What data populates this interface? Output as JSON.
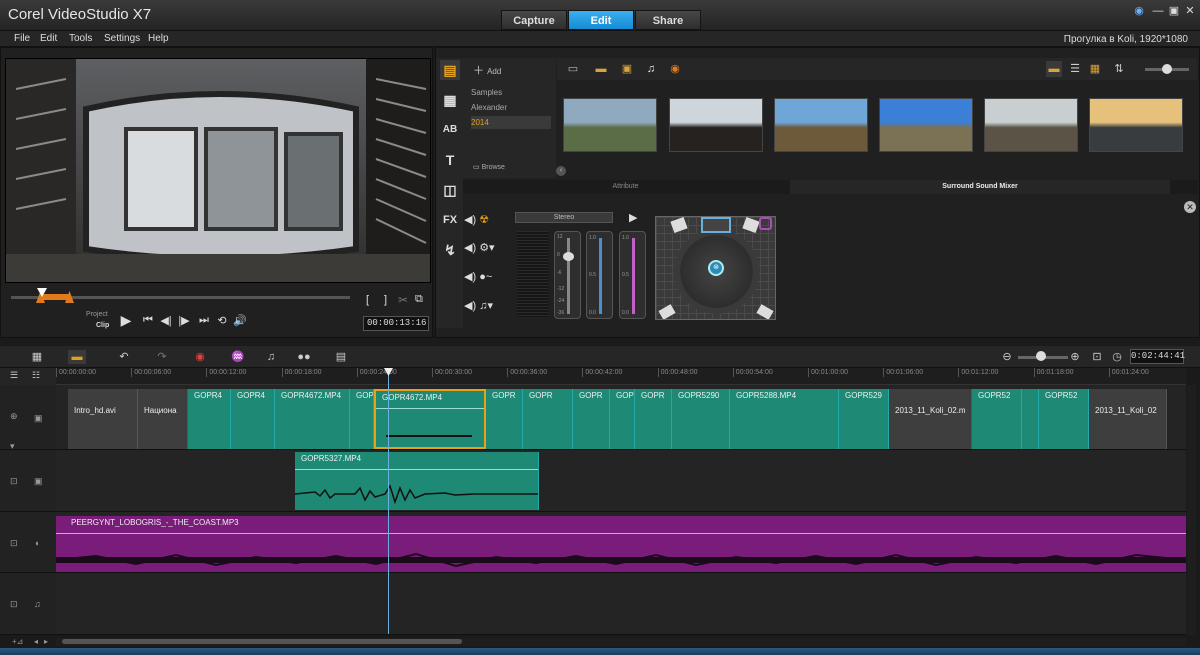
{
  "app": {
    "title": "Corel VideoStudio X7"
  },
  "main_tabs": [
    {
      "label": "Capture"
    },
    {
      "label": "Edit"
    },
    {
      "label": "Share"
    }
  ],
  "window_controls": {
    "globe_icon": "globe-icon",
    "minimize": "—",
    "restore": "▣",
    "close": "✕"
  },
  "menu": [
    "File",
    "Edit",
    "Tools",
    "Settings",
    "Help"
  ],
  "project_info": "Прогулка в Koli, 1920*1080",
  "player": {
    "mode_project": "Project",
    "mode_clip": "Clip",
    "timecode": "00:00:13:16",
    "controls": {
      "play": "▶",
      "home": "⏮",
      "prev_frame": "◀|",
      "next_frame": "|▶",
      "end": "⏭",
      "repeat": "⟲",
      "volume": "🔊"
    },
    "mark_in": "[",
    "mark_out": "]"
  },
  "library": {
    "add_label": "Add",
    "browse_label": "Browse",
    "folders": [
      "Samples",
      "Alexander",
      "2014"
    ],
    "selected_folder": "2014",
    "thumbnails": [
      {
        "name": "thumb-1",
        "colors": [
          "#8fa9bf",
          "#5b6d46"
        ]
      },
      {
        "name": "thumb-2",
        "colors": [
          "#cfd6db",
          "#262220"
        ]
      },
      {
        "name": "thumb-3",
        "colors": [
          "#6ea6d8",
          "#6d5a3a"
        ]
      },
      {
        "name": "thumb-4",
        "colors": [
          "#3b7fd6",
          "#7b7255"
        ]
      },
      {
        "name": "thumb-5",
        "colors": [
          "#c9ced0",
          "#5a5346"
        ]
      },
      {
        "name": "thumb-6",
        "colors": [
          "#e5c17c",
          "#383c3e"
        ]
      }
    ]
  },
  "options": {
    "tab_attribute": "Attribute",
    "tab_surround": "Surround Sound Mixer",
    "stereo_label": "Stereo",
    "fader_ticks_left": [
      "12",
      "0",
      "-6",
      "-12",
      "-24",
      "-36"
    ],
    "fader_ticks_mid": [
      "1.0",
      "0.5",
      "0.0"
    ],
    "fader_ticks_right": [
      "1.0",
      "0.5",
      "0.0"
    ]
  },
  "timeline": {
    "duration": "0:02:44:41",
    "ruler": [
      "00:00:00:00",
      "00:00:06:00",
      "00:00:12:00",
      "00:00:18:00",
      "00:00:24:00",
      "00:00:30:00",
      "00:00:36:00",
      "00:00:42:00",
      "00:00:48:00",
      "00:00:54:00",
      "00:01:00:00",
      "00:01:06:00",
      "00:01:12:00",
      "00:01:18:00",
      "00:01:24:00"
    ],
    "video_clips": [
      {
        "label": "Intro_hd.avi",
        "kind": "gray"
      },
      {
        "label": "Национа",
        "kind": "gray"
      },
      {
        "label": "GOPR4",
        "kind": "teal"
      },
      {
        "label": "GOPR4",
        "kind": "teal"
      },
      {
        "label": "GOPR4672.MP4",
        "kind": "teal"
      },
      {
        "label": "GOPR",
        "kind": "teal"
      },
      {
        "label": "GOPR4672.MP4",
        "kind": "sel"
      },
      {
        "label": "GOPR",
        "kind": "teal"
      },
      {
        "label": "GOPR",
        "kind": "teal"
      },
      {
        "label": "GOPR",
        "kind": "teal"
      },
      {
        "label": "GOPR",
        "kind": "teal"
      },
      {
        "label": "GOPR",
        "kind": "teal"
      },
      {
        "label": "GOPR5290",
        "kind": "teal"
      },
      {
        "label": "GOPR5288.MP4",
        "kind": "teal"
      },
      {
        "label": "GOPR529",
        "kind": "teal"
      },
      {
        "label": "2013_11_Koli_02.m",
        "kind": "gray"
      },
      {
        "label": "GOPR52",
        "kind": "teal"
      },
      {
        "label": "",
        "kind": "teal"
      },
      {
        "label": "GOPR52",
        "kind": "teal"
      },
      {
        "label": "2013_11_Koli_02",
        "kind": "gray"
      }
    ],
    "overlay_clip": "GOPR5327.MP4",
    "music_clip": "PEERGYNT_LOBOGRIS_-_THE_COAST.MP3"
  }
}
